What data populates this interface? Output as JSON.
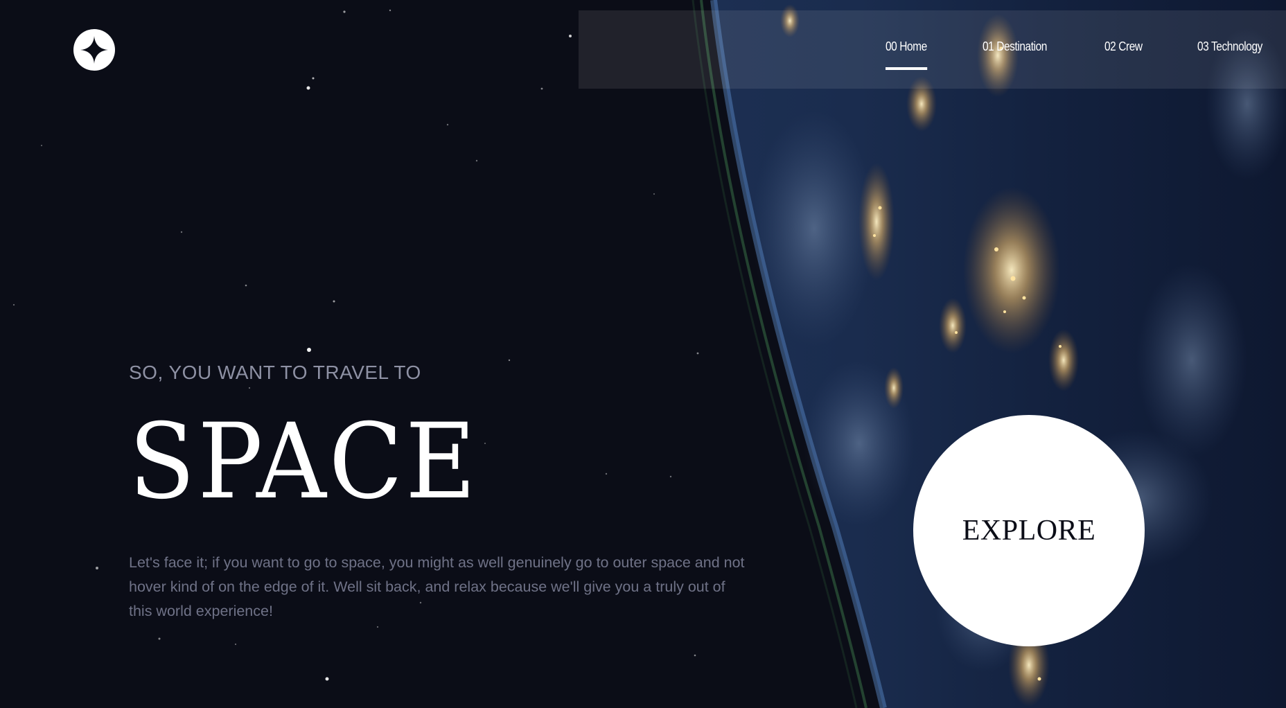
{
  "brand": {
    "logo_icon": "four-point-star-icon"
  },
  "nav": {
    "items": [
      {
        "number": "00",
        "label": "Home",
        "text": "00 Home",
        "active": true
      },
      {
        "number": "01",
        "label": "Destination",
        "text": "01 Destination",
        "active": false
      },
      {
        "number": "02",
        "label": "Crew",
        "text": "02 Crew",
        "active": false
      },
      {
        "number": "03",
        "label": "Technology",
        "text": "03 Technology",
        "active": false
      }
    ]
  },
  "hero": {
    "kicker": "SO, YOU WANT TO TRAVEL TO",
    "title": "SPACE",
    "body": "Let's face it; if you want to go to space, you might as well genuinely go to outer space and not hover kind of on the edge of it. Well sit back, and relax because we'll give you a truly out of this world experience!",
    "cta_label": "EXPLORE"
  },
  "colors": {
    "background": "#0b0d17",
    "text_primary": "#ffffff",
    "text_muted": "#8e91a4",
    "cta_background": "#ffffff",
    "cta_text": "#0b0d17"
  }
}
